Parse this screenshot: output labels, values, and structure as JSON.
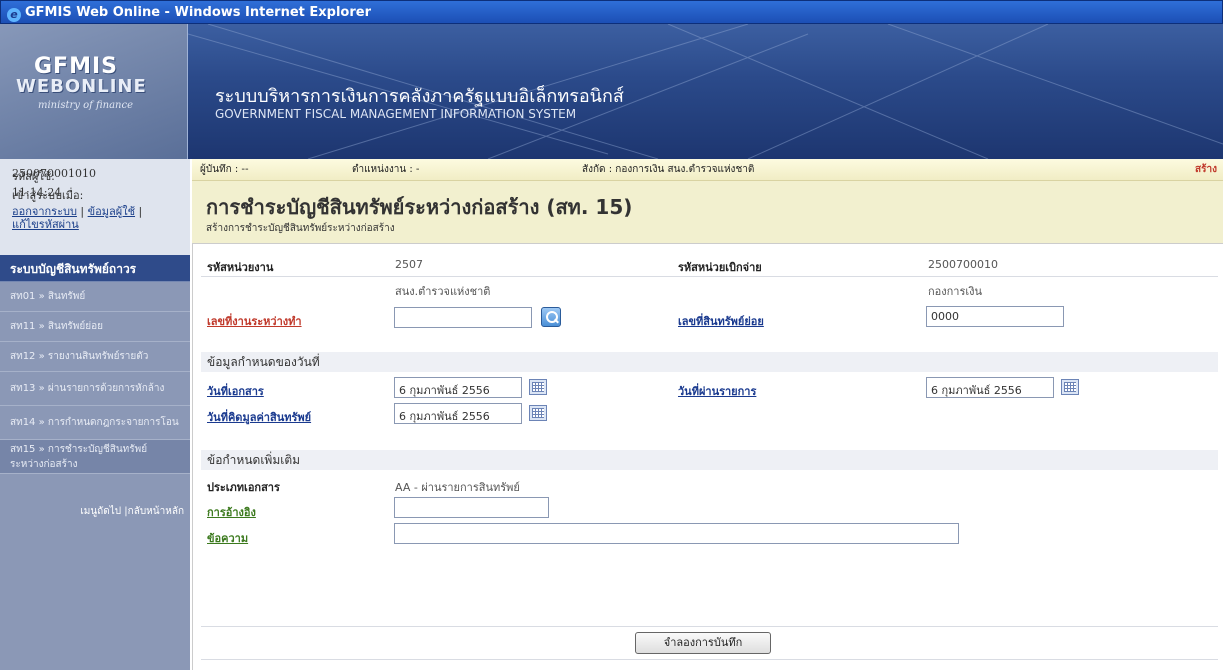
{
  "window": {
    "title": "GFMIS Web Online - Windows Internet Explorer"
  },
  "banner": {
    "logo_line1": "GFMIS",
    "logo_line2": "WEBONLINE",
    "logo_line3": "ministry of finance",
    "title_th": "ระบบบริหารการเงินการคลังภาครัฐแบบอิเล็กทรอนิกส์",
    "title_en": "GOVERNMENT FISCAL MANAGEMENT INFORMATION SYSTEM"
  },
  "sidebar": {
    "user_id_label": "รหัสผู้ใช้:",
    "user_id": "250070001010",
    "login_label": "เข้าสู่ระบบเมื่อ:",
    "login_time": "11:14:24",
    "logout": "ออกจากระบบ",
    "user_info": "ข้อมูลผู้ใช้",
    "change_password": "แก้ไขรหัสผ่าน",
    "menu_title": "ระบบบัญชีสินทรัพย์ถาวร",
    "items": [
      {
        "label": "สท01 » สินทรัพย์"
      },
      {
        "label": "สท11 » สินทรัพย์ย่อย"
      },
      {
        "label": "สท12 » รายงานสินทรัพย์รายตัว"
      },
      {
        "label": "สท13 » ผ่านรายการด้วยการหักล้าง"
      },
      {
        "label": "สท14 » การกำหนดกฎกระจายการโอน"
      },
      {
        "label": "สท15 » การชำระบัญชีสินทรัพย์ระหว่างก่อสร้าง"
      }
    ],
    "footer": "เมนูถัดไป |กลับหน้าหลัก"
  },
  "infobar": {
    "recorder": "ผู้บันทึก : --",
    "position": "ตำแหน่งงาน : -",
    "affiliation": "สังกัด : กองการเงิน สนง.ตำรวจแห่งชาติ",
    "status": "สร้าง"
  },
  "page": {
    "title": "การชำระบัญชีสินทรัพย์ระหว่างก่อสร้าง (สท. 15)",
    "subtitle": "สร้างการชำระบัญชีสินทรัพย์ระหว่างก่อสร้าง"
  },
  "form": {
    "agency_code_label": "รหัสหน่วยงาน",
    "agency_code": "2507",
    "agency_name": "สนง.ตำรวจแห่งชาติ",
    "disburse_code_label": "รหัสหน่วยเบิกจ่าย",
    "disburse_code": "2500700010",
    "disburse_name": "กองการเงิน",
    "wip_label": "เลขที่งานระหว่างทำ",
    "wip_value": "",
    "sub_asset_label": "เลขที่สินทรัพย์ย่อย",
    "sub_asset_value": "0000",
    "section_dates": "ข้อมูลกำหนดของวันที่",
    "doc_date_label": "วันที่เอกสาร",
    "doc_date": "6 กุมภาพันธ์ 2556",
    "post_date_label": "วันที่ผ่านรายการ",
    "post_date": "6 กุมภาพันธ์ 2556",
    "value_date_label": "วันที่คิดมูลค่าสินทรัพย์",
    "value_date": "6 กุมภาพันธ์ 2556",
    "section_extra": "ข้อกำหนดเพิ่มเติม",
    "doc_type_label": "ประเภทเอกสาร",
    "doc_type": "AA - ผ่านรายการสินทรัพย์",
    "reference_label": "การอ้างอิง",
    "reference_value": "",
    "text_label": "ข้อความ",
    "text_value": "",
    "simulate_button": "จำลองการบันทึก"
  }
}
